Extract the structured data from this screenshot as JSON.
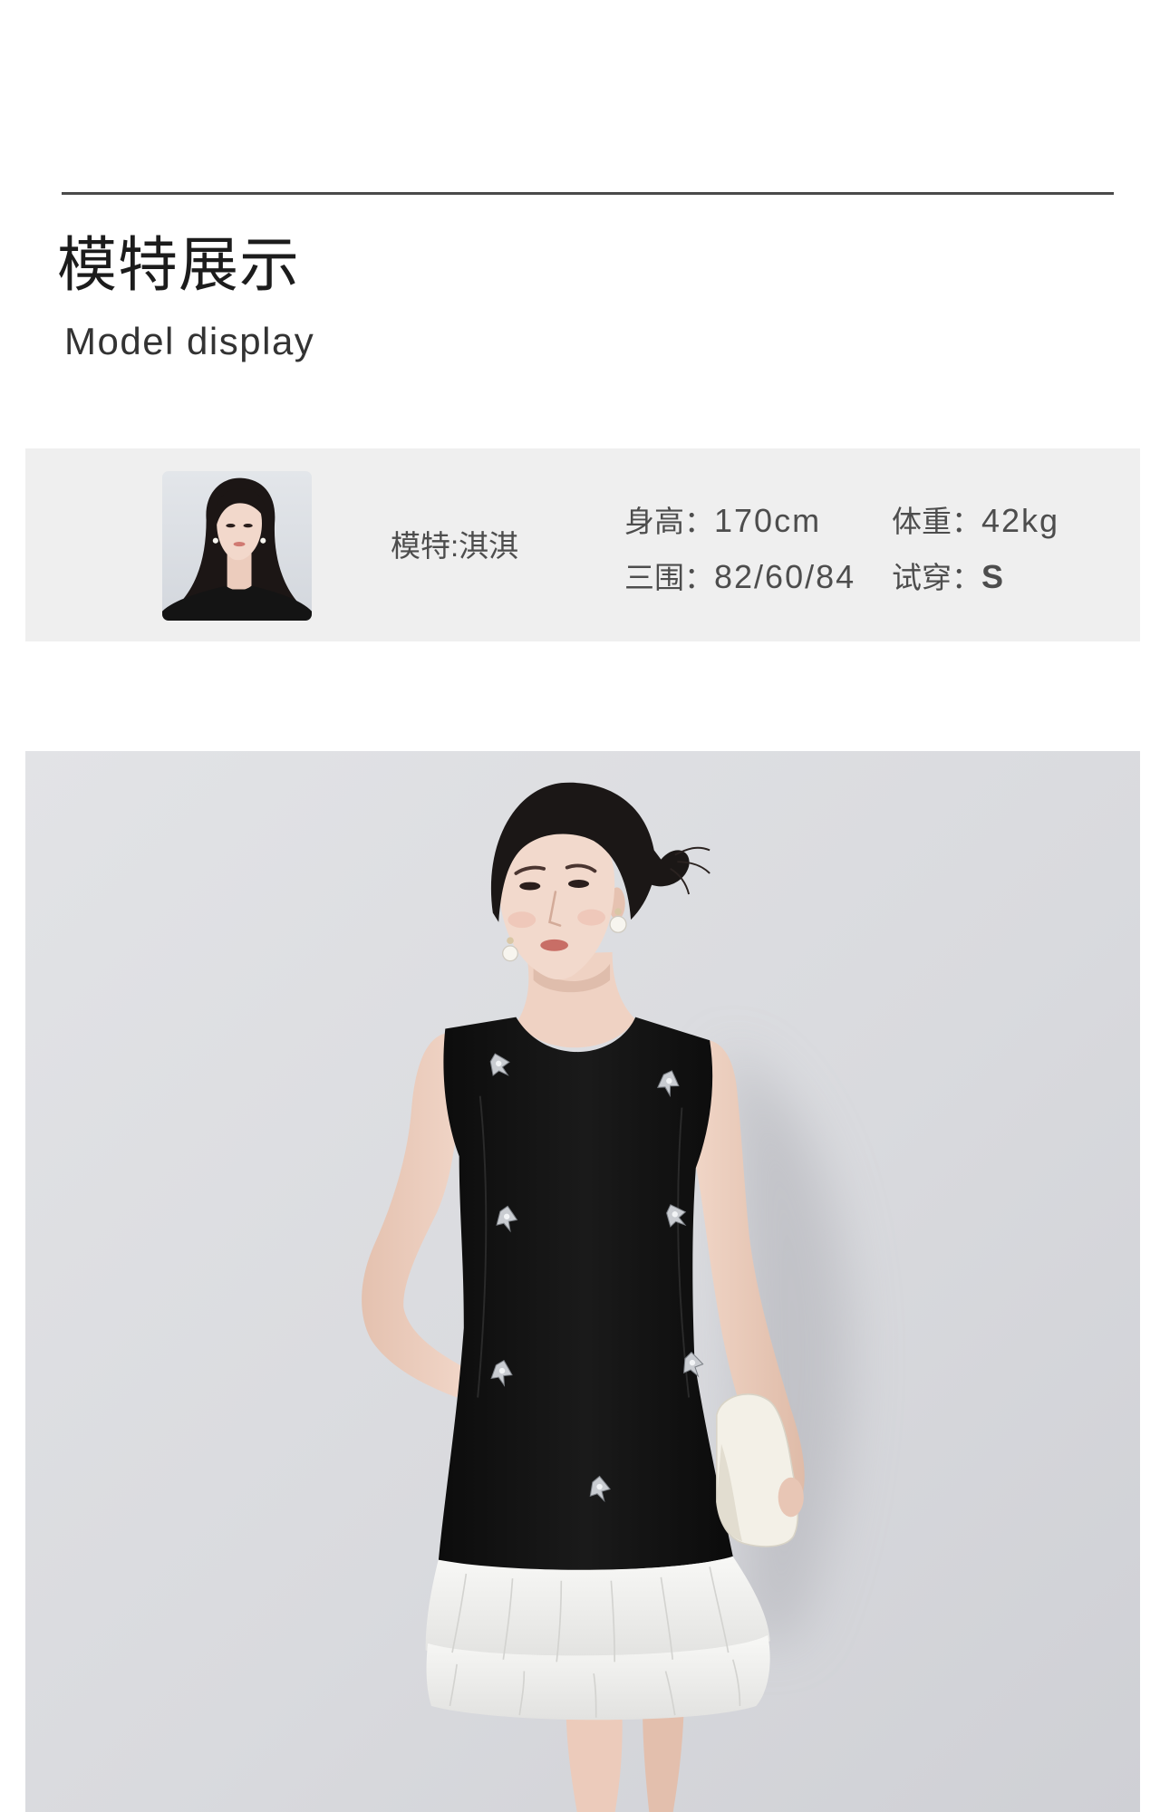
{
  "section": {
    "title": "模特展示",
    "subtitle": "Model display"
  },
  "model_info": {
    "name_label": "模特:淇淇",
    "stats": [
      {
        "label": "身高：",
        "value": "170cm"
      },
      {
        "label": "体重：",
        "value": "42kg"
      },
      {
        "label": "三围：",
        "value": "82/60/84"
      },
      {
        "label": "试穿：",
        "value": "S"
      }
    ]
  },
  "colors": {
    "divider": "#4a4a4a",
    "panel-bg": "#efefef",
    "heading": "#1c1c1c",
    "text": "#4d4d4d"
  }
}
